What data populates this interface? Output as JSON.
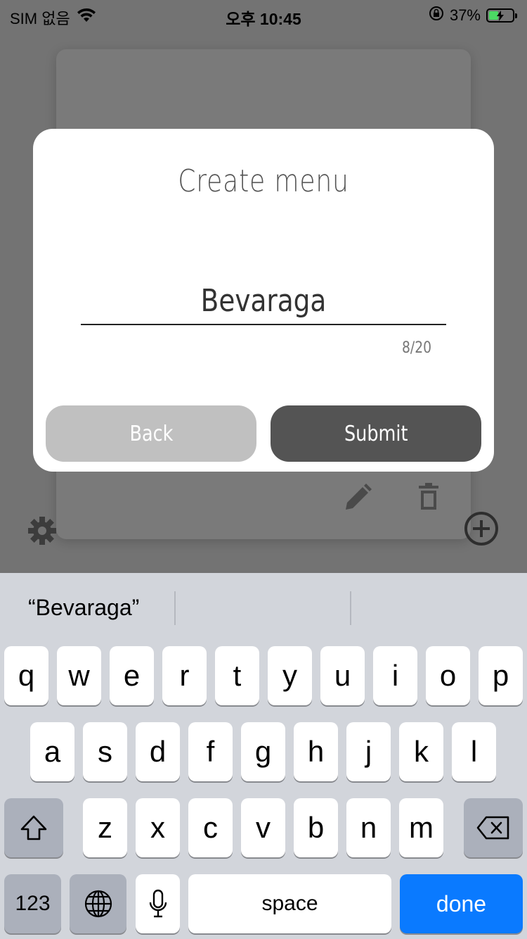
{
  "status_bar": {
    "carrier": "SIM 없음",
    "time": "오후 10:45",
    "battery_percent": "37%"
  },
  "modal": {
    "title": "Create menu",
    "input_value": "Bevaraga",
    "counter": "8/20",
    "back_label": "Back",
    "submit_label": "Submit"
  },
  "background_icons": [
    "pencil-icon",
    "trash-icon",
    "gear-icon",
    "plus-circle-icon"
  ],
  "keyboard": {
    "suggestion": "“Bevaraga”",
    "row1": [
      "q",
      "w",
      "e",
      "r",
      "t",
      "y",
      "u",
      "i",
      "o",
      "p"
    ],
    "row2": [
      "a",
      "s",
      "d",
      "f",
      "g",
      "h",
      "j",
      "k",
      "l"
    ],
    "row3": [
      "z",
      "x",
      "c",
      "v",
      "b",
      "n",
      "m"
    ],
    "numbers_label": "123",
    "space_label": "space",
    "done_label": "done"
  },
  "colors": {
    "overlay": "#737373",
    "back_button": "#c0c0c0",
    "submit_button": "#545454",
    "done_key": "#0a7aff",
    "battery_fill": "#4cd964"
  }
}
